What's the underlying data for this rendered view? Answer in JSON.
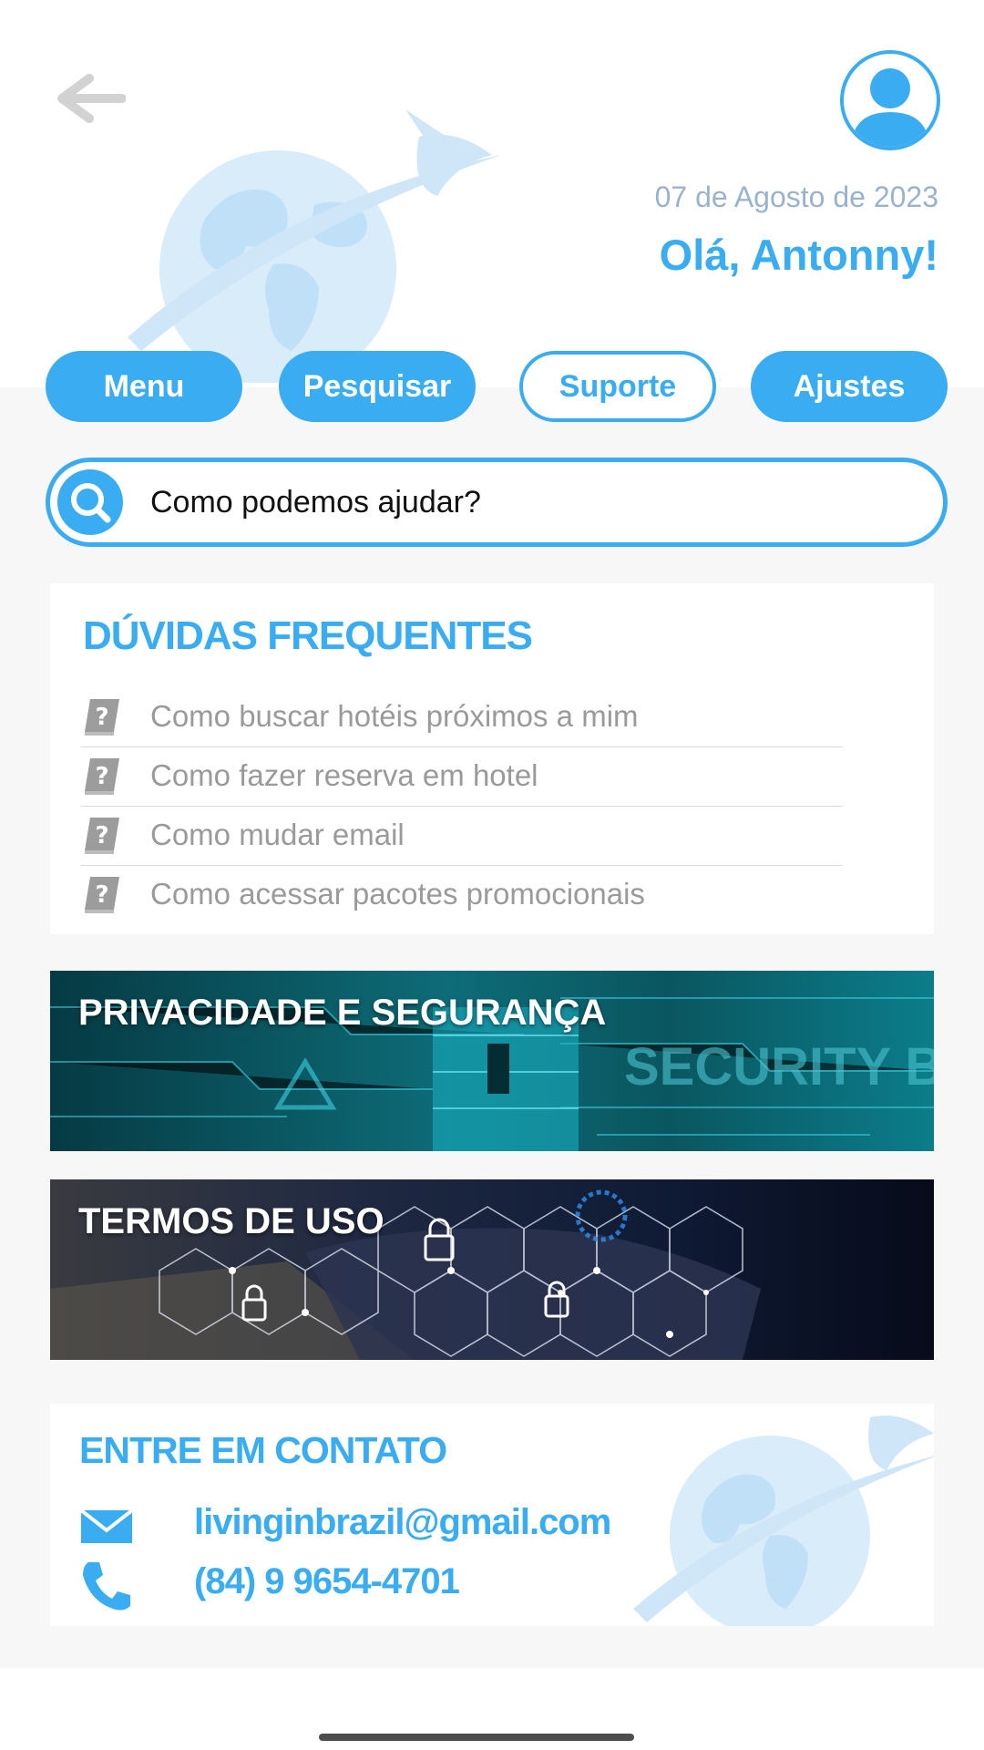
{
  "header": {
    "date": "07 de Agosto de 2023",
    "greeting": "Olá, Antonny!"
  },
  "nav": {
    "items": [
      {
        "label": "Menu"
      },
      {
        "label": "Pesquisar"
      },
      {
        "label": "Suporte",
        "active": true
      },
      {
        "label": "Ajustes"
      }
    ]
  },
  "search": {
    "placeholder": "Como podemos ajudar?"
  },
  "faq": {
    "title": "DÚVIDAS FREQUENTES",
    "items": [
      {
        "label": "Como buscar hotéis próximos a mim"
      },
      {
        "label": "Como fazer reserva em hotel"
      },
      {
        "label": "Como mudar email"
      },
      {
        "label": "Como acessar pacotes promocionais"
      }
    ]
  },
  "banners": {
    "privacy": {
      "title": "PRIVACIDADE E SEGURANÇA",
      "image_text": "SECURITY B"
    },
    "terms": {
      "title": "TERMOS DE USO"
    }
  },
  "contact": {
    "title": "ENTRE EM CONTATO",
    "email": "livinginbrazil@gmail.com",
    "phone": "(84) 9 9654-4701"
  },
  "colors": {
    "accent": "#3aacf2",
    "date_text": "#9ab3cc",
    "faq_text": "#9a9a9a",
    "background": "#f7f7f7"
  },
  "icons": [
    "back-arrow-icon",
    "user-avatar-icon",
    "search-icon",
    "question-book-icon",
    "mail-icon",
    "phone-icon",
    "globe-hummingbird-logo"
  ]
}
